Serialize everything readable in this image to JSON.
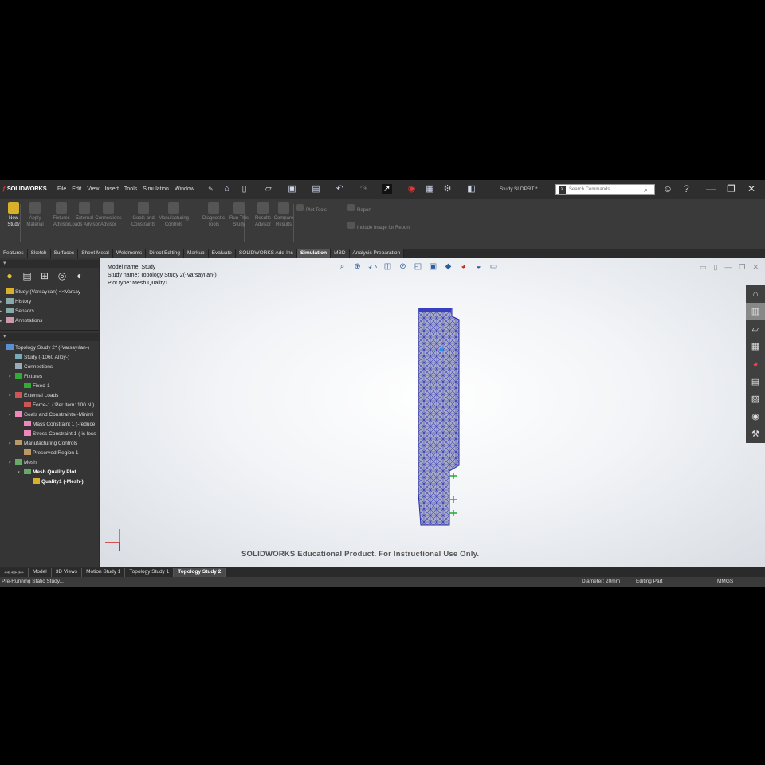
{
  "app": {
    "logo": "SOLIDWORKS",
    "menus": [
      "File",
      "Edit",
      "View",
      "Insert",
      "Tools",
      "Simulation",
      "Window"
    ],
    "doc_title": "Study.SLDPRT *",
    "search_placeholder": "Search Commands"
  },
  "command_manager": [
    {
      "label": "New Study",
      "active": true
    },
    {
      "label": "Apply Material",
      "active": false
    },
    {
      "label": "Fixtures Advisor",
      "active": false
    },
    {
      "label": "External Loads Advisor",
      "active": false
    },
    {
      "label": "Connections Advisor",
      "active": false
    },
    {
      "label": "Goals and Constraints",
      "active": false
    },
    {
      "label": "Manufacturing Controls",
      "active": false
    },
    {
      "label": "Diagnostic Tools",
      "active": false
    },
    {
      "label": "Run This Study",
      "active": false
    },
    {
      "label": "Results Advisor",
      "active": false
    },
    {
      "label": "Compare Results",
      "active": false
    },
    {
      "label": "Plot Tools",
      "active": false
    },
    {
      "label": "Report",
      "active": false
    },
    {
      "label": "Include Image for Report",
      "active": false
    }
  ],
  "tabs": [
    "Features",
    "Sketch",
    "Surfaces",
    "Sheet Metal",
    "Weldments",
    "Direct Editing",
    "Markup",
    "Evaluate",
    "SOLIDWORKS Add-Ins",
    "Simulation",
    "MBD",
    "Analysis Preparation"
  ],
  "active_tab": "Simulation",
  "feature_tree": [
    "Study (Varsayılan) <<Varsay",
    "History",
    "Sensors",
    "Annotations"
  ],
  "sim_tree": [
    {
      "label": "Topology Study 2* (-Varsayılan-)",
      "indent": 0,
      "bold": false
    },
    {
      "label": "Study (-1060 Alloy-)",
      "indent": 1,
      "bold": false
    },
    {
      "label": "Connections",
      "indent": 1,
      "bold": false
    },
    {
      "label": "Fixtures",
      "indent": 1,
      "bold": false
    },
    {
      "label": "Fixed-1",
      "indent": 2,
      "bold": false
    },
    {
      "label": "External Loads",
      "indent": 1,
      "bold": false
    },
    {
      "label": "Force-1 (:Per item: 100 N:)",
      "indent": 2,
      "bold": false
    },
    {
      "label": "Goals and Constraints(-Minimi",
      "indent": 1,
      "bold": false
    },
    {
      "label": "Mass Constraint 1 (-reduce",
      "indent": 2,
      "bold": false
    },
    {
      "label": "Stress Constraint 1 (-is less",
      "indent": 2,
      "bold": false
    },
    {
      "label": "Manufacturing Controls",
      "indent": 1,
      "bold": false
    },
    {
      "label": "Preserved Region 1",
      "indent": 2,
      "bold": false
    },
    {
      "label": "Mesh",
      "indent": 1,
      "bold": false
    },
    {
      "label": "Mesh Quality Plot",
      "indent": 2,
      "bold": true
    },
    {
      "label": "Quality1 (-Mesh-)",
      "indent": 3,
      "bold": true
    }
  ],
  "viewport": {
    "model_name": "Model name: Study",
    "study_name": "Study name: Topology Study 2(-Varsayılan-)",
    "plot_type": "Plot type: Mesh Quality1",
    "watermark": "SOLIDWORKS Educational Product. For Instructional Use Only."
  },
  "bottom_tabs": [
    "Model",
    "3D Views",
    "Motion Study 1",
    "Topology Study 1",
    "Topology Study 2"
  ],
  "active_bottom_tab": "Topology Study 2",
  "status": {
    "left": "Pre-Running Static Study...",
    "diameter": "Diameter: 20mm",
    "mode": "Editing Part",
    "units": "MMGS"
  }
}
